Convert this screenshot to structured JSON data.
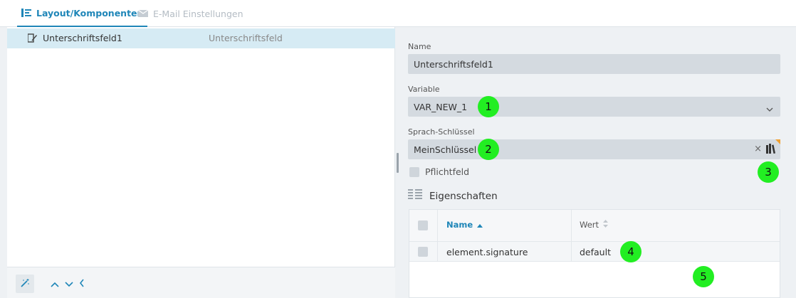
{
  "tabs": [
    {
      "label": "Layout/Komponenten",
      "icon": "tree-layout-icon",
      "active": true
    },
    {
      "label": "E-Mail Einstellungen",
      "icon": "envelope-icon",
      "active": false
    }
  ],
  "tree": {
    "items": [
      {
        "label": "Unterschriftsfeld1",
        "type": "Unterschriftsfeld",
        "icon": "signature-edit-icon",
        "selected": true
      }
    ]
  },
  "footer": {
    "buttons": [
      "magic-wand-icon",
      "chevron-up-icon",
      "chevron-down-icon",
      "chevron-left-icon"
    ]
  },
  "form": {
    "name_label": "Name",
    "name_value": "Unterschriftsfeld1",
    "variable_label": "Variable",
    "variable_value": "VAR_NEW_1",
    "language_key_label": "Sprach-Schlüssel",
    "language_key_value": "MeinSchlüssel",
    "clear_symbol": "×",
    "required_label": "Pflichtfeld"
  },
  "properties": {
    "title": "Eigenschaften",
    "columns": [
      {
        "label": "Name",
        "sort": "asc"
      },
      {
        "label": "Wert",
        "sort": "none"
      }
    ],
    "rows": [
      {
        "name": "element.signature",
        "value": "default"
      }
    ]
  },
  "markers": [
    "1",
    "2",
    "3",
    "4",
    "5"
  ],
  "colors": {
    "accent": "#1f86b8",
    "selected_row": "#d6ebf4",
    "field_bg": "#d4dae0",
    "marker": "#22ee22"
  }
}
